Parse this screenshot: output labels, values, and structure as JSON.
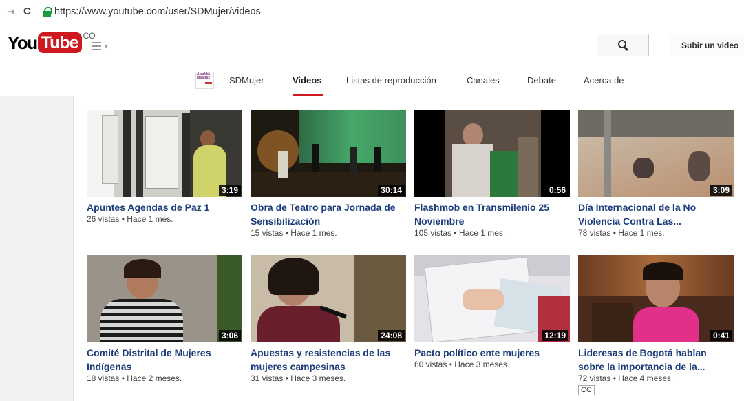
{
  "browser": {
    "url": "https://www.youtube.com/user/SDMujer/videos",
    "back_icon": "back-arrow-icon",
    "reload_icon": "reload-icon",
    "lock_icon": "lock-icon"
  },
  "masthead": {
    "logo_you": "You",
    "logo_tube": "Tube",
    "logo_country": "CO",
    "search_placeholder": "",
    "search_value": "",
    "upload_label": "Subir un video"
  },
  "channel": {
    "thumb_text": "Alcaldía mujeres",
    "tabs": [
      {
        "label": "SDMujer",
        "active": false
      },
      {
        "label": "Videos",
        "active": true
      },
      {
        "label": "Listas de reproducción",
        "active": false
      },
      {
        "label": "Canales",
        "active": false
      },
      {
        "label": "Debate",
        "active": false
      },
      {
        "label": "Acerca de",
        "active": false
      }
    ]
  },
  "videos": [
    {
      "title": "Apuntes Agendas de Paz 1",
      "meta": "26 vistas • Hace 1 mes.",
      "duration": "3:19",
      "cc": ""
    },
    {
      "title": "Obra de Teatro para Jornada de Sensibilización",
      "meta": "15 vistas • Hace 1 mes.",
      "duration": "30:14",
      "cc": ""
    },
    {
      "title": "Flashmob en Transmilenio 25 Noviembre",
      "meta": "105 vistas • Hace 1 mes.",
      "duration": "0:56",
      "cc": ""
    },
    {
      "title": "Día Internacional de la No Violencia Contra Las...",
      "meta": "78 vistas • Hace 1 mes.",
      "duration": "3:09",
      "cc": ""
    },
    {
      "title": "Comité Distrital de Mujeres Indígenas",
      "meta": "18 vistas • Hace 2 meses.",
      "duration": "3:06",
      "cc": ""
    },
    {
      "title": "Apuestas y resistencias de las mujeres campesinas",
      "meta": "31 vistas • Hace 3 meses.",
      "duration": "24:08",
      "cc": ""
    },
    {
      "title": "Pacto político ente mujeres",
      "meta": "60 vistas • Hace 3 meses.",
      "duration": "12:19",
      "cc": ""
    },
    {
      "title": "Lideresas de Bogotá hablan sobre la importancia de la...",
      "meta": "72 vistas • Hace 4 meses.",
      "duration": "0:41",
      "cc": "CC"
    }
  ]
}
